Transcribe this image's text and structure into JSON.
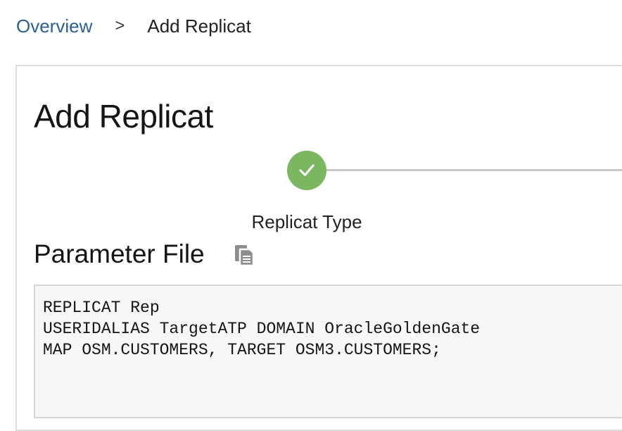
{
  "breadcrumb": {
    "overview": "Overview",
    "separator": ">",
    "current": "Add Replicat"
  },
  "page": {
    "title": "Add Replicat"
  },
  "train": {
    "steps": [
      {
        "label": "Replicat Type",
        "status": "completed",
        "icon": "checkmark-icon"
      }
    ]
  },
  "parameter_file": {
    "title": "Parameter File",
    "copy_icon": "copy-icon",
    "lines": [
      "REPLICAT Rep",
      "USERIDALIAS TargetATP DOMAIN OracleGoldenGate",
      "MAP OSM.CUSTOMERS, TARGET OSM3.CUSTOMERS;"
    ]
  },
  "colors": {
    "link": "#2b6095",
    "step_complete": "#7bb661",
    "connector": "#c8c8c8",
    "editor_background": "#f7f7f7"
  }
}
